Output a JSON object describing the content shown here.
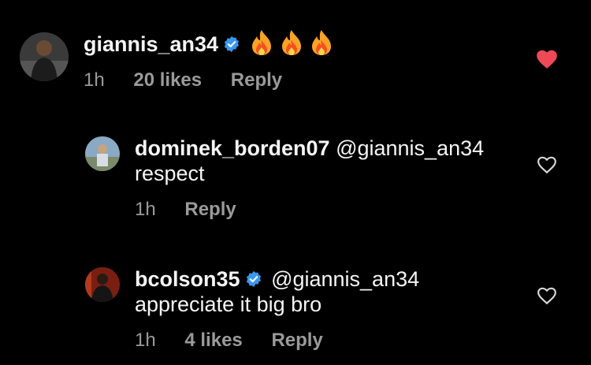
{
  "comments": [
    {
      "username": "giannis_an34",
      "verified": true,
      "text_emoji": "fire-icon x3",
      "time": "1h",
      "likes": "20 likes",
      "reply_label": "Reply",
      "liked": true,
      "heart_color": "#ed4956"
    },
    {
      "username": "dominek_borden07",
      "verified": false,
      "mention": "@giannis_an34",
      "text": "respect",
      "time": "1h",
      "reply_label": "Reply",
      "liked": false
    },
    {
      "username": "bcolson35",
      "verified": true,
      "mention": "@giannis_an34",
      "text": "appreciate it big bro",
      "time": "1h",
      "likes": "4 likes",
      "reply_label": "Reply",
      "liked": false
    }
  ],
  "colors": {
    "background": "#000000",
    "verified_badge": "#3897f0",
    "meta_text": "#9a9a9a"
  }
}
